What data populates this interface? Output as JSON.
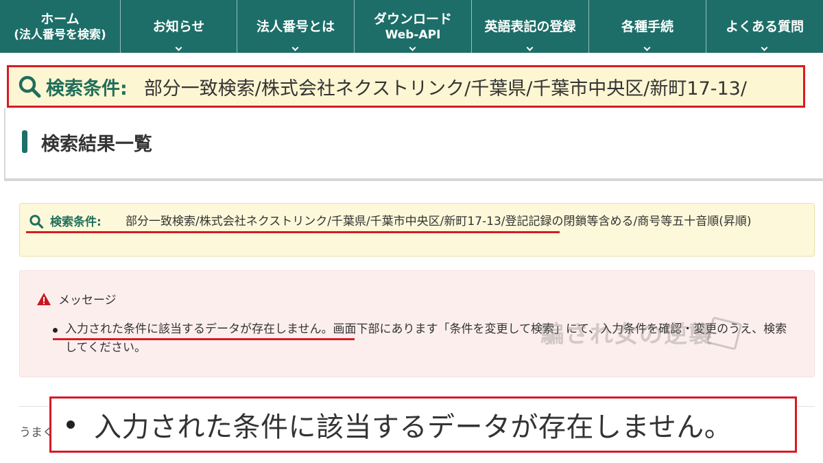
{
  "nav": {
    "items": [
      {
        "label": "ホーム",
        "sub": "(法人番号を検索)"
      },
      {
        "label": "お知らせ"
      },
      {
        "label": "法人番号とは"
      },
      {
        "label": "ダウンロード",
        "sub": "Web-API"
      },
      {
        "label": "英語表記の登録"
      },
      {
        "label": "各種手続"
      },
      {
        "label": "よくある質問"
      }
    ]
  },
  "zoom_condition": {
    "label": "検索条件:",
    "value": "部分一致検索/株式会社ネクストリンク/千葉県/千葉市中央区/新町17-13/"
  },
  "page_title": "検索結果一覧",
  "search_condition": {
    "label": "検索条件:",
    "value": "部分一致検索/株式会社ネクストリンク/千葉県/千葉市中央区/新町17-13/登記記録の閉鎖等含める/商号等五十音順(昇順)"
  },
  "message": {
    "heading": "メッセージ",
    "text": "入力された条件に該当するデータが存在しません。画面下部にあります「条件を変更して検索」にて、入力条件を確認・変更のうえ、検索してください。"
  },
  "watermark": "騙され女の逆襲",
  "footer_partial": "うまく",
  "zoom_message": "入力された条件に該当するデータが存在しません。",
  "colors": {
    "nav_bg": "#1d6e68",
    "accent_green": "#1f6e5a",
    "highlight_red": "#d71a24",
    "condition_bg": "#fdf8da",
    "message_bg": "#fdeeee"
  }
}
